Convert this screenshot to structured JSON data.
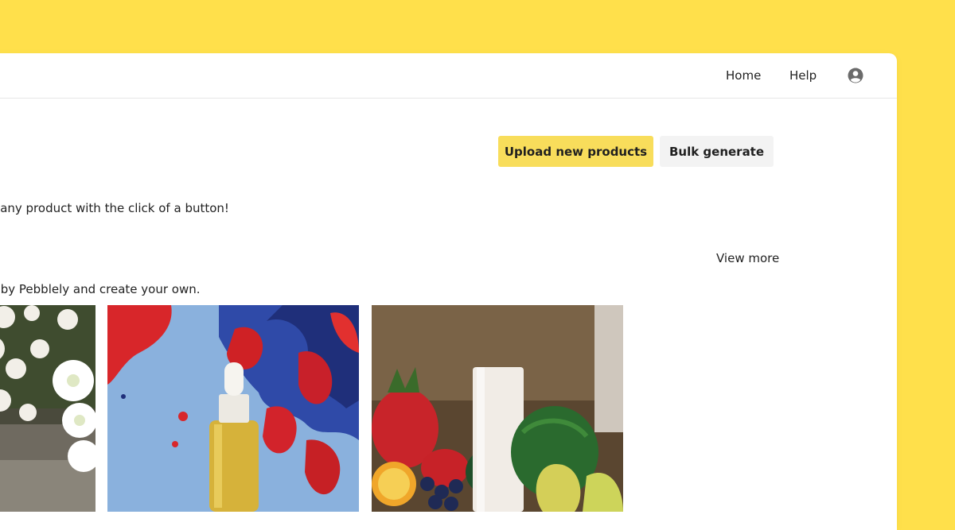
{
  "nav": {
    "home": "Home",
    "help": "Help",
    "account_icon": "user-circle-icon"
  },
  "actions": {
    "upload": "Upload new products",
    "bulk": "Bulk generate"
  },
  "intro": {
    "subtitle": "shots of any product with the click of a button!"
  },
  "gallery": {
    "view_more": "View more",
    "caption": "rated by Pebblely and create your own.",
    "images": [
      "flowers-photo",
      "serum-bottle-paint-splash-photo",
      "lotion-tube-fruits-photo"
    ]
  },
  "colors": {
    "background": "#FFE04B",
    "primary_button": "#F8DD5B",
    "secondary_button": "#F3F3F3"
  }
}
